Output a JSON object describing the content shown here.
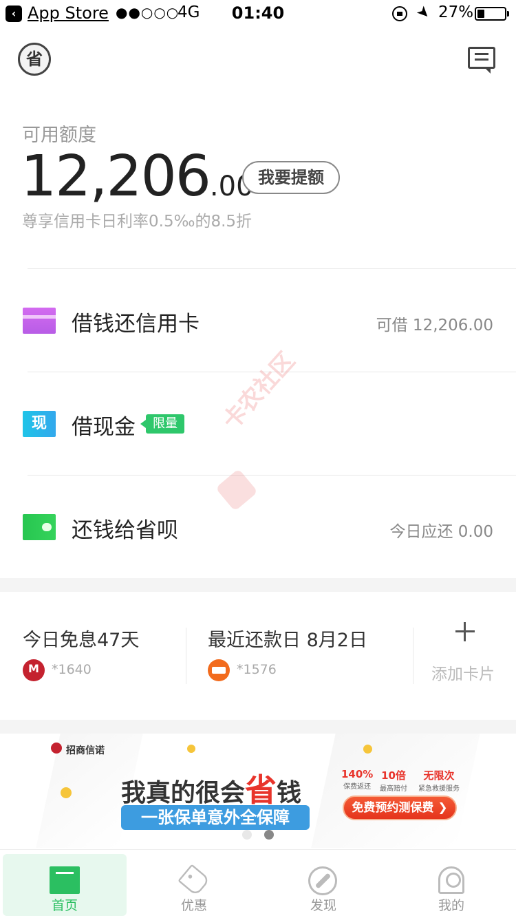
{
  "status_bar": {
    "back_app": "App Store",
    "signal": "●●○○○",
    "network": "4G",
    "time": "01:40",
    "battery_percent": "27%",
    "battery_level": 0.27
  },
  "header": {
    "logo_text": "省",
    "message_icon": "message-icon"
  },
  "credit": {
    "label": "可用额度",
    "amount_int": "12,206",
    "amount_dec": ".00",
    "withdraw_button": "我要提额",
    "subtitle": "尊享信用卡日利率0.5‰的8.5折"
  },
  "menu": [
    {
      "title": "借钱还信用卡",
      "right": "可借 12,206.00",
      "icon": "credit-card-icon"
    },
    {
      "title": "借现金",
      "tag": "限量",
      "icon_text": "现",
      "icon": "cash-icon"
    },
    {
      "title": "还钱给省呗",
      "right": "今日应还 0.00",
      "icon": "wallet-icon"
    }
  ],
  "watermark": "卡农社区",
  "cards": [
    {
      "title": "今日免息47天",
      "number": "*1640",
      "bank_icon": "cmb-bank-icon"
    },
    {
      "title": "最近还款日 8月2日",
      "number": "*1576",
      "bank_icon": "bank-logo-icon"
    }
  ],
  "add_card": {
    "label": "添加卡片"
  },
  "banner": {
    "brand": "招商信诺",
    "headline_before": "我真的很会",
    "headline_highlight": "省",
    "headline_after": "钱",
    "subline": "一张保单意外全保障",
    "stats": [
      {
        "value": "140%",
        "label": "保费返还"
      },
      {
        "value": "10倍",
        "label": "最高赔付"
      },
      {
        "value": "无限次",
        "label": "紧急救援服务"
      }
    ],
    "cta": "免费预约测保费 ❯",
    "page_count": 2,
    "active_page": 2
  },
  "tabs": [
    {
      "label": "首页",
      "icon": "home-icon",
      "active": true
    },
    {
      "label": "优惠",
      "icon": "tag-icon",
      "active": false
    },
    {
      "label": "发现",
      "icon": "compass-icon",
      "active": false
    },
    {
      "label": "我的",
      "icon": "profile-icon",
      "active": false
    }
  ],
  "colors": {
    "accent_green": "#2bbf61",
    "card_purple": "#c063ec",
    "cash_blue": "#22b8ea",
    "wallet_green": "#2ec955",
    "banner_red": "#e8342b",
    "banner_blue": "#3d9ce0"
  }
}
